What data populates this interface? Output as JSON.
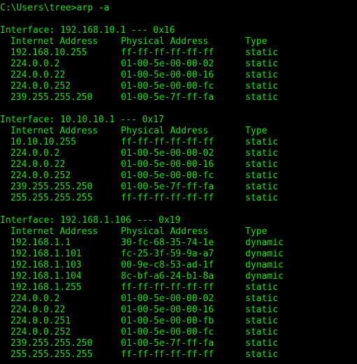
{
  "terminal": {
    "colors": {
      "background": "#000000",
      "foreground": "#19e019"
    },
    "prompt_line": "C:\\Users\\tree>arp -a",
    "blank": " ",
    "columns": {
      "internet_address": "Internet Address",
      "physical_address": "Physical Address",
      "type": "Type"
    },
    "interfaces": [
      {
        "header": "Interface: 192.168.10.1 --- 0x16",
        "rows": [
          {
            "ip": "192.168.10.255",
            "mac": "ff-ff-ff-ff-ff-ff",
            "type": "static"
          },
          {
            "ip": "224.0.0.2",
            "mac": "01-00-5e-00-00-02",
            "type": "static"
          },
          {
            "ip": "224.0.0.22",
            "mac": "01-00-5e-00-00-16",
            "type": "static"
          },
          {
            "ip": "224.0.0.252",
            "mac": "01-00-5e-00-00-fc",
            "type": "static"
          },
          {
            "ip": "239.255.255.250",
            "mac": "01-00-5e-7f-ff-fa",
            "type": "static"
          }
        ]
      },
      {
        "header": "Interface: 10.10.10.1 --- 0x17",
        "rows": [
          {
            "ip": "10.10.10.255",
            "mac": "ff-ff-ff-ff-ff-ff",
            "type": "static"
          },
          {
            "ip": "224.0.0.2",
            "mac": "01-00-5e-00-00-02",
            "type": "static"
          },
          {
            "ip": "224.0.0.22",
            "mac": "01-00-5e-00-00-16",
            "type": "static"
          },
          {
            "ip": "224.0.0.252",
            "mac": "01-00-5e-00-00-fc",
            "type": "static"
          },
          {
            "ip": "239.255.255.250",
            "mac": "01-00-5e-7f-ff-fa",
            "type": "static"
          },
          {
            "ip": "255.255.255.255",
            "mac": "ff-ff-ff-ff-ff-ff",
            "type": "static"
          }
        ]
      },
      {
        "header": "Interface: 192.168.1.106 --- 0x19",
        "rows": [
          {
            "ip": "192.168.1.1",
            "mac": "30-fc-68-35-74-1e",
            "type": "dynamic"
          },
          {
            "ip": "192.168.1.101",
            "mac": "fc-25-3f-59-9a-a7",
            "type": "dynamic"
          },
          {
            "ip": "192.168.1.103",
            "mac": "00-9e-c8-53-ad-1f",
            "type": "dynamic"
          },
          {
            "ip": "192.168.1.104",
            "mac": "8c-bf-a6-24-b1-8a",
            "type": "dynamic"
          },
          {
            "ip": "192.168.1.255",
            "mac": "ff-ff-ff-ff-ff-ff",
            "type": "static"
          },
          {
            "ip": "224.0.0.2",
            "mac": "01-00-5e-00-00-02",
            "type": "static"
          },
          {
            "ip": "224.0.0.22",
            "mac": "01-00-5e-00-00-16",
            "type": "static"
          },
          {
            "ip": "224.0.0.251",
            "mac": "01-00-5e-00-00-fb",
            "type": "static"
          },
          {
            "ip": "224.0.0.252",
            "mac": "01-00-5e-00-00-fc",
            "type": "static"
          },
          {
            "ip": "239.255.255.250",
            "mac": "01-00-5e-7f-ff-fa",
            "type": "static"
          },
          {
            "ip": "255.255.255.255",
            "mac": "ff-ff-ff-ff-ff-ff",
            "type": "static"
          }
        ]
      }
    ]
  }
}
